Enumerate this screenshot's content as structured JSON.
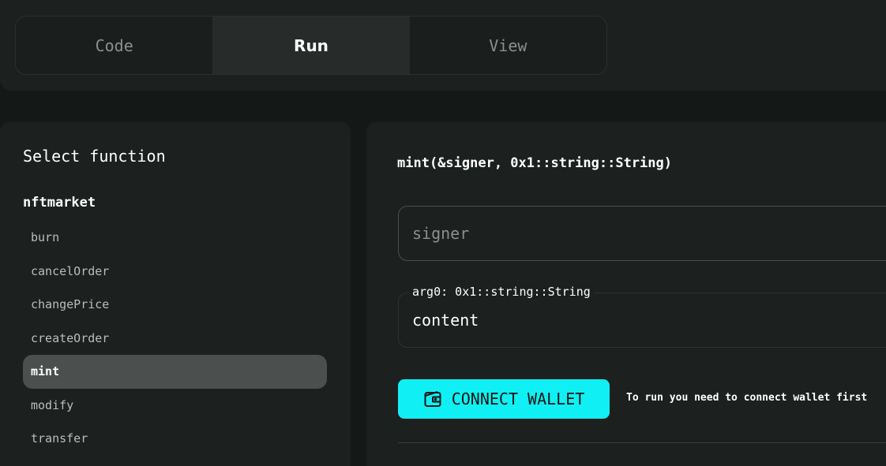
{
  "tabs": [
    {
      "label": "Code",
      "active": false
    },
    {
      "label": "Run",
      "active": true
    },
    {
      "label": "View",
      "active": false
    }
  ],
  "sidebar": {
    "title": "Select function",
    "module": "nftmarket",
    "functions": [
      "burn",
      "cancelOrder",
      "changePrice",
      "createOrder",
      "mint",
      "modify",
      "transfer"
    ],
    "selected": "mint"
  },
  "main": {
    "signature": "mint(&signer, 0x1::string::String)",
    "signer_placeholder": "signer",
    "arg0_label": "arg0: 0x1::string::String",
    "arg0_value": "content",
    "connect_label": "CONNECT WALLET",
    "hint": "To run you need to connect wallet first"
  },
  "colors": {
    "accent": "#10f0f4",
    "background": "#141817",
    "panel": "#1c201f",
    "selected_item": "#4b504e"
  },
  "icons": {
    "connect_button": "wallet-icon"
  }
}
